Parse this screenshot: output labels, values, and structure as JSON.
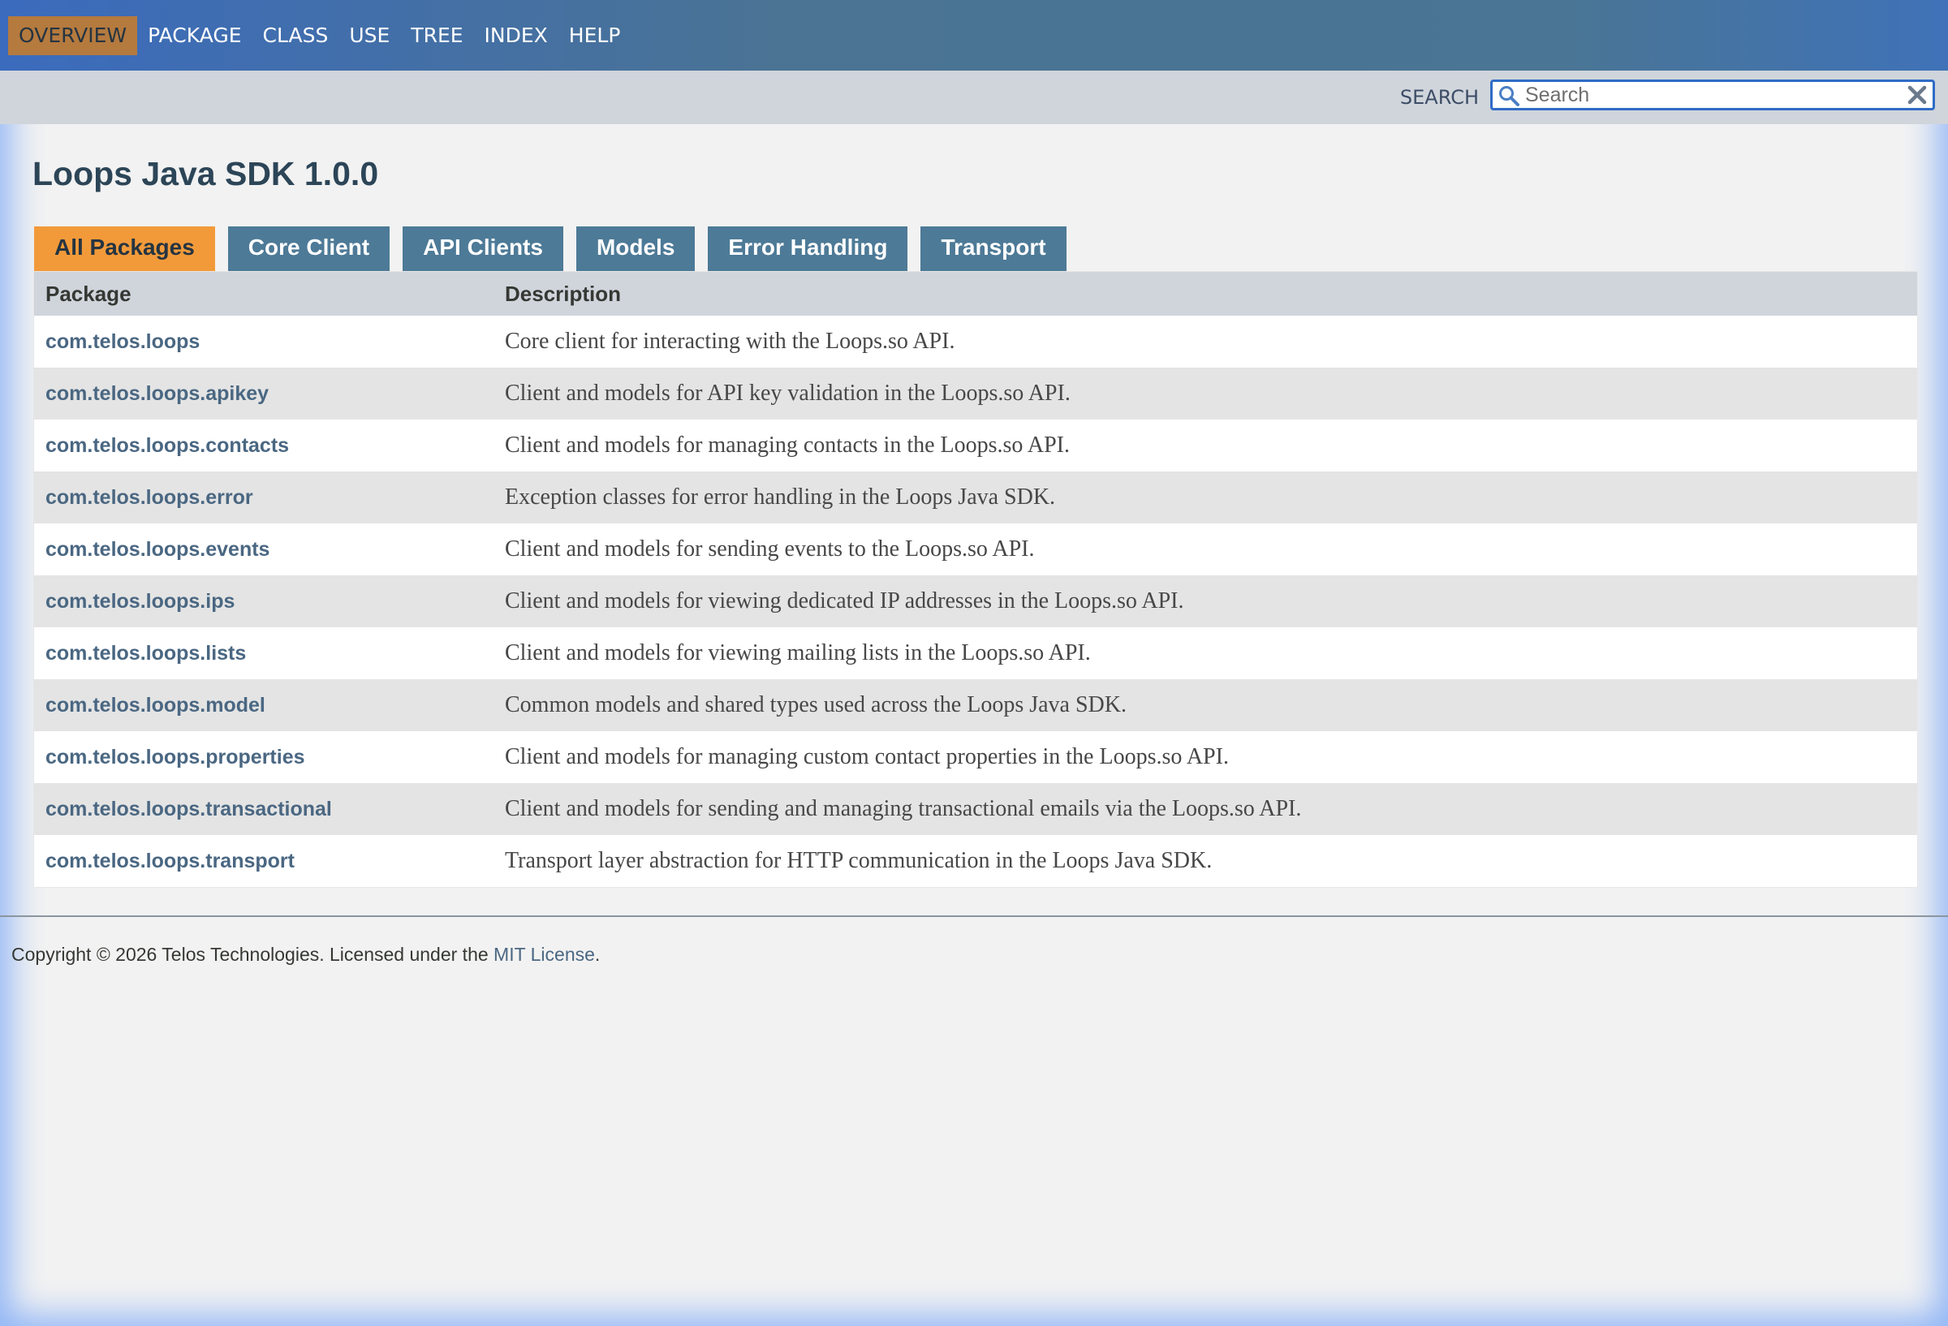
{
  "top_nav": {
    "items": [
      {
        "label": "OVERVIEW",
        "active": true
      },
      {
        "label": "PACKAGE",
        "active": false
      },
      {
        "label": "CLASS",
        "active": false
      },
      {
        "label": "USE",
        "active": false
      },
      {
        "label": "TREE",
        "active": false
      },
      {
        "label": "INDEX",
        "active": false
      },
      {
        "label": "HELP",
        "active": false
      }
    ]
  },
  "search": {
    "label": "SEARCH",
    "placeholder": "Search",
    "value": ""
  },
  "page_title": "Loops Java SDK 1.0.0",
  "tabs": [
    {
      "label": "All Packages",
      "active": true
    },
    {
      "label": "Core Client",
      "active": false
    },
    {
      "label": "API Clients",
      "active": false
    },
    {
      "label": "Models",
      "active": false
    },
    {
      "label": "Error Handling",
      "active": false
    },
    {
      "label": "Transport",
      "active": false
    }
  ],
  "table": {
    "headers": {
      "package": "Package",
      "description": "Description"
    },
    "rows": [
      {
        "package": "com.telos.loops",
        "description": "Core client for interacting with the Loops.so API."
      },
      {
        "package": "com.telos.loops.apikey",
        "description": "Client and models for API key validation in the Loops.so API."
      },
      {
        "package": "com.telos.loops.contacts",
        "description": "Client and models for managing contacts in the Loops.so API."
      },
      {
        "package": "com.telos.loops.error",
        "description": "Exception classes for error handling in the Loops Java SDK."
      },
      {
        "package": "com.telos.loops.events",
        "description": "Client and models for sending events to the Loops.so API."
      },
      {
        "package": "com.telos.loops.ips",
        "description": "Client and models for viewing dedicated IP addresses in the Loops.so API."
      },
      {
        "package": "com.telos.loops.lists",
        "description": "Client and models for viewing mailing lists in the Loops.so API."
      },
      {
        "package": "com.telos.loops.model",
        "description": "Common models and shared types used across the Loops Java SDK."
      },
      {
        "package": "com.telos.loops.properties",
        "description": "Client and models for managing custom contact properties in the Loops.so API."
      },
      {
        "package": "com.telos.loops.transactional",
        "description": "Client and models for sending and managing transactional emails via the Loops.so API."
      },
      {
        "package": "com.telos.loops.transport",
        "description": "Transport layer abstraction for HTTP communication in the Loops Java SDK."
      }
    ]
  },
  "footer": {
    "text": "Copyright © 2026 Telos Technologies. Licensed under the ",
    "link": "MIT License",
    "suffix": "."
  },
  "colors": {
    "nav_bar": "#4a7594",
    "active_nav": "#b57a3e",
    "active_tab": "#f29a3a",
    "tab": "#4d7a97",
    "link": "#4a6782",
    "search_border": "#2f6cc6"
  },
  "icons": {
    "search": "search-icon",
    "reset": "close-icon"
  }
}
